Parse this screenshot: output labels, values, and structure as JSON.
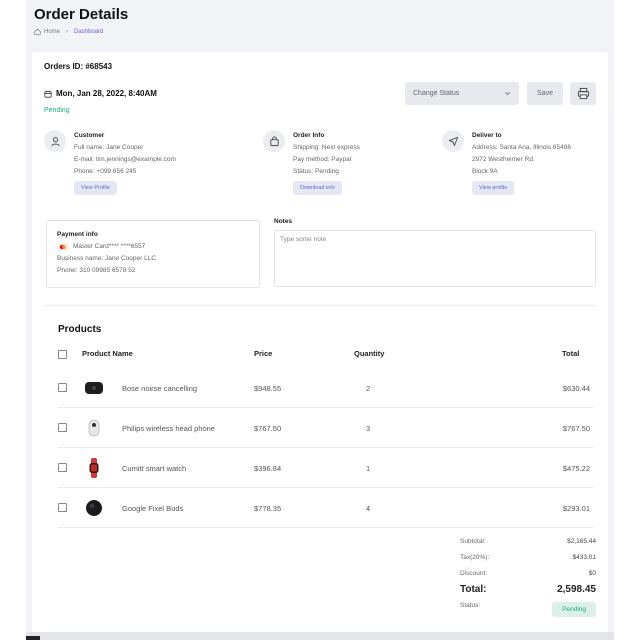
{
  "header": {
    "title": "Order Details",
    "breadcrumb": {
      "home": "Home",
      "separator": "›",
      "current": "Dashboard"
    }
  },
  "order": {
    "id_label": "Orders ID: #68543",
    "date": "Mon, Jan 28, 2022, 8:40AM",
    "status": "Pending",
    "change_status_placeholder": "Change Status",
    "save_label": "Save"
  },
  "customer": {
    "heading": "Customer",
    "full_name": "Full name: Jane Cooper",
    "email": "E-mail: tim.jennings@example.com",
    "phone": "Phone: +099 856 245",
    "button": "View Profile"
  },
  "order_info": {
    "heading": "Order Info",
    "shipping": "Shipping: Next express",
    "pay_method": "Pay method: Paypal",
    "status": "Status: Pending",
    "button": "Download info"
  },
  "deliver_to": {
    "heading": "Deliver to",
    "address": "Address: Santa Ana, Illinois 85486",
    "street": "2972 Westheimer Rd.",
    "block": "Block 9A",
    "button": "View profile"
  },
  "payment": {
    "heading": "Payment info",
    "card": "Master Card**** ****6557",
    "business": "Business name: Jane Cooper LLC",
    "phone": "Phone: 310 09985 6578 52"
  },
  "notes": {
    "label": "Notes",
    "placeholder": "Type some note"
  },
  "products": {
    "heading": "Products",
    "columns": {
      "name": "Product Name",
      "price": "Price",
      "quantity": "Quantity",
      "total": "Total"
    },
    "rows": [
      {
        "name": "Bose noirse cancelling",
        "price": "$948.55",
        "quantity": "2",
        "total": "$630.44",
        "icon": "headphones-case-icon"
      },
      {
        "name": "Philips wireless head phone",
        "price": "$767.50",
        "quantity": "3",
        "total": "$767.50",
        "icon": "earbuds-icon"
      },
      {
        "name": "Cumitt smart watch",
        "price": "$396.84",
        "quantity": "1",
        "total": "$475.22",
        "icon": "smartwatch-icon"
      },
      {
        "name": "Google Fixel Buds",
        "price": "$778.35",
        "quantity": "4",
        "total": "$293.01",
        "icon": "buds-icon"
      }
    ]
  },
  "summary": {
    "subtotal_label": "Subtotal:",
    "subtotal": "$2,165.44",
    "tax_label": "Tax(20%):",
    "tax": "$433.01",
    "discount_label": "Discount:",
    "discount": "$0",
    "total_label": "Total:",
    "total": "2,598.45",
    "status_label": "Status:",
    "status": "Pending"
  },
  "colors": {
    "accent": "#6b5fd3",
    "success": "#18b07a",
    "button_bg": "#e7e9ee"
  }
}
